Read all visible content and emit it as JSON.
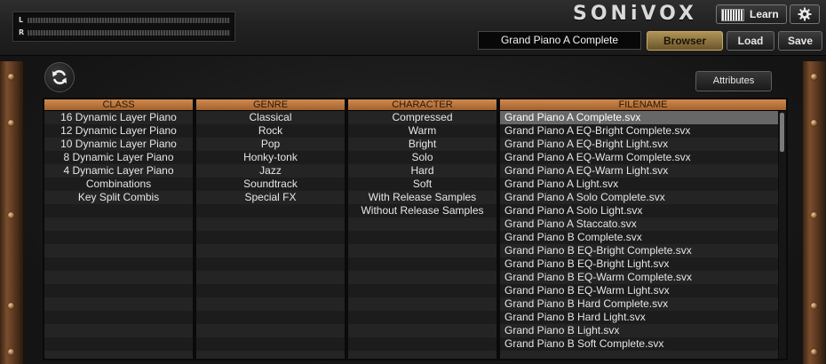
{
  "meters": {
    "left_label": "L",
    "right_label": "R"
  },
  "brand": "SONiVOX",
  "toolbar": {
    "learn_label": "Learn",
    "patch_name": "Grand Piano A Complete",
    "browser_label": "Browser",
    "load_label": "Load",
    "save_label": "Save"
  },
  "browser": {
    "attributes_label": "Attributes",
    "columns": {
      "class": {
        "header": "CLASS",
        "items": [
          "16 Dynamic Layer Piano",
          "12 Dynamic Layer Piano",
          "10 Dynamic Layer Piano",
          "8 Dynamic Layer Piano",
          "4 Dynamic Layer Piano",
          "Combinations",
          "Key Split Combis"
        ]
      },
      "genre": {
        "header": "GENRE",
        "items": [
          "Classical",
          "Rock",
          "Pop",
          "Honky-tonk",
          "Jazz",
          "Soundtrack",
          "Special FX"
        ]
      },
      "character": {
        "header": "CHARACTER",
        "items": [
          "Compressed",
          "Warm",
          "Bright",
          "Solo",
          "Hard",
          "Soft",
          "With Release Samples",
          "Without Release Samples"
        ]
      },
      "filename": {
        "header": "FILENAME",
        "selected_index": 0,
        "items": [
          "Grand Piano A Complete.svx",
          "Grand Piano A EQ-Bright Complete.svx",
          "Grand Piano A EQ-Bright Light.svx",
          "Grand Piano A EQ-Warm Complete.svx",
          "Grand Piano A EQ-Warm Light.svx",
          "Grand Piano A Light.svx",
          "Grand Piano A Solo Complete.svx",
          "Grand Piano A Solo Light.svx",
          "Grand Piano A Staccato.svx",
          "Grand Piano B Complete.svx",
          "Grand Piano B EQ-Bright Complete.svx",
          "Grand Piano B EQ-Bright Light.svx",
          "Grand Piano B EQ-Warm Complete.svx",
          "Grand Piano B EQ-Warm Light.svx",
          "Grand Piano B Hard Complete.svx",
          "Grand Piano B Hard Light.svx",
          "Grand Piano B Light.svx",
          "Grand Piano B Soft Complete.svx"
        ]
      }
    }
  },
  "colors": {
    "browser_button": "#a8894e",
    "column_header": "#b87040",
    "selected_row": "#676767"
  }
}
